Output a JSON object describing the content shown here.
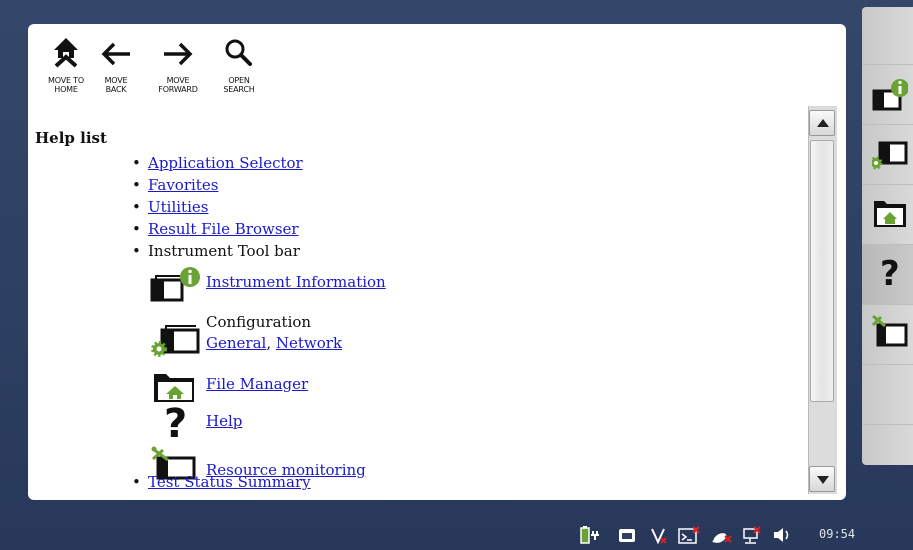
{
  "toolbar": {
    "home_label": "MOVE TO\nHOME",
    "back_label": "MOVE\nBACK",
    "forward_label": "MOVE\nFORWARD",
    "search_label": "OPEN\nSEARCH"
  },
  "content": {
    "title": "Help list",
    "items": [
      {
        "label": "Application Selector",
        "link": true
      },
      {
        "label": "Favorites",
        "link": true
      },
      {
        "label": "Utilities",
        "link": true
      },
      {
        "label": "Result File Browser",
        "link": true
      },
      {
        "label": "Instrument Tool bar",
        "link": false
      }
    ],
    "toolbar_entries": {
      "instrument_info": "Instrument Information",
      "configuration": "Configuration",
      "general": "General",
      "comma": ",",
      "network": "Network",
      "file_manager": "File Manager",
      "help": "Help",
      "resource_monitoring": "Resource monitoring"
    },
    "last_item": "Test Status Summary"
  },
  "side_panel": {
    "buttons": [
      "instrument-info-icon",
      "configuration-icon",
      "file-manager-icon",
      "help-icon",
      "resource-monitoring-icon"
    ],
    "active": "help-icon"
  },
  "status": {
    "clock": "09:54",
    "icons": [
      "battery-plug-icon",
      "screen-icon",
      "v-status-icon",
      "terminal-icon",
      "satellite-icon",
      "network-icon",
      "volume-icon"
    ]
  },
  "colors": {
    "accent_green": "#6aa334",
    "link": "#1a1acc",
    "background": "#2e4063"
  }
}
